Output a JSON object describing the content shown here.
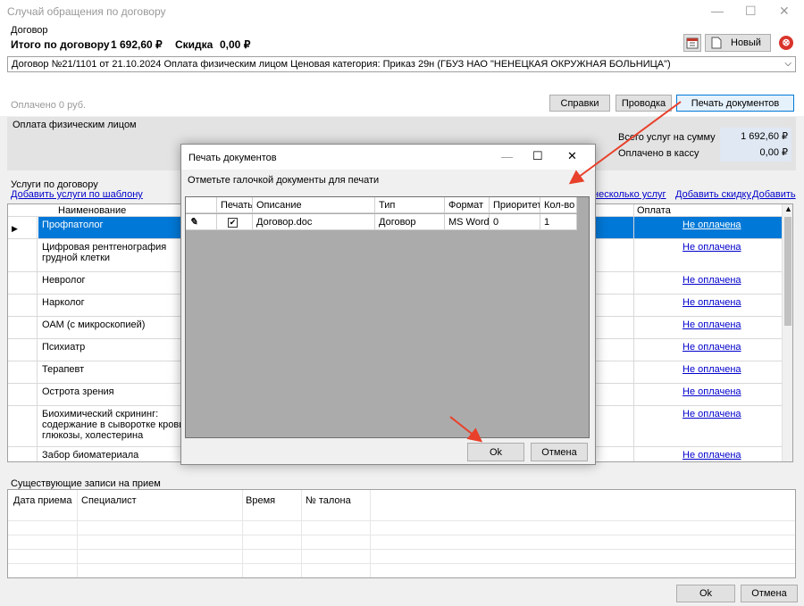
{
  "window": {
    "title": "Случай обращения по договору",
    "min_glyph": "—",
    "max_glyph": "☐",
    "close_glyph": "✕"
  },
  "contract": {
    "group_label": "Договор",
    "total_label": "Итого по договору",
    "total_value": "1 692,60 ₽",
    "discount_label": "Скидка",
    "discount_value": "0,00 ₽",
    "new_button": "Новый",
    "selector_value": "Договор №21/1101 от 21.10.2024 Оплата физическим лицом Ценовая категория: Приказ 29н (ГБУЗ НАО \"НЕНЕЦКАЯ ОКРУЖНАЯ БОЛЬНИЦА\")",
    "paid_text": "Оплачено 0 руб.",
    "btn_references": "Справки",
    "btn_posting": "Проводка",
    "btn_print_docs": "Печать документов"
  },
  "payment": {
    "label": "Оплата физическим лицом",
    "total_services_label": "Всего услуг на сумму",
    "total_services_value": "1 692,60 ₽",
    "paid_cash_label": "Оплачено в кассу",
    "paid_cash_value": "0,00 ₽"
  },
  "services": {
    "group_label": "Услуги по договору",
    "link_add_template": "Добавить услуги по шаблону",
    "link_add_several": "несколько услуг",
    "link_add_discount": "Добавить скидку",
    "link_add": "Добавить",
    "col_name": "Наименование",
    "col_payment": "Оплата",
    "rows": [
      {
        "name": "Профпатолог",
        "payment": "Не оплачена"
      },
      {
        "name": "Цифровая рентгенография грудной клетки",
        "payment": "Не оплачена"
      },
      {
        "name": "Невролог",
        "payment": "Не оплачена"
      },
      {
        "name": "Нарколог",
        "payment": "Не оплачена"
      },
      {
        "name": "ОАМ (с микроскопией)",
        "payment": "Не оплачена"
      },
      {
        "name": "Психиатр",
        "payment": "Не оплачена"
      },
      {
        "name": "Терапевт",
        "payment": "Не оплачена"
      },
      {
        "name": "Острота зрения",
        "payment": "Не оплачена"
      },
      {
        "name": "Биохимический скрининг: содержание в сыворотке крови глюкозы, холестерина",
        "payment": "Не оплачена"
      },
      {
        "name": "Забор биоматериала",
        "payment": "Не оплачена"
      }
    ]
  },
  "dialog": {
    "title": "Печать документов",
    "hint": "Отметьте галочкой документы для печати",
    "columns": {
      "print": "Печать",
      "description": "Описание",
      "type": "Тип",
      "format": "Формат",
      "priority": "Приоритет",
      "count": "Кол-во"
    },
    "rows": [
      {
        "checked": "✔",
        "description": "Договор.doc",
        "type": "Договор",
        "format": "MS Word",
        "priority": "0",
        "count": "1"
      }
    ],
    "ok": "Ok",
    "cancel": "Отмена"
  },
  "appointments": {
    "group_label": "Существующие записи на прием",
    "col_date": "Дата приема",
    "col_specialist": "Специалист",
    "col_time": "Время",
    "col_ticket": "№ талона"
  },
  "footer": {
    "ok": "Ok",
    "cancel": "Отмена"
  },
  "colors": {
    "selection": "#0078d7",
    "link": "#0000cc",
    "annotation_arrow": "#e8402a"
  }
}
